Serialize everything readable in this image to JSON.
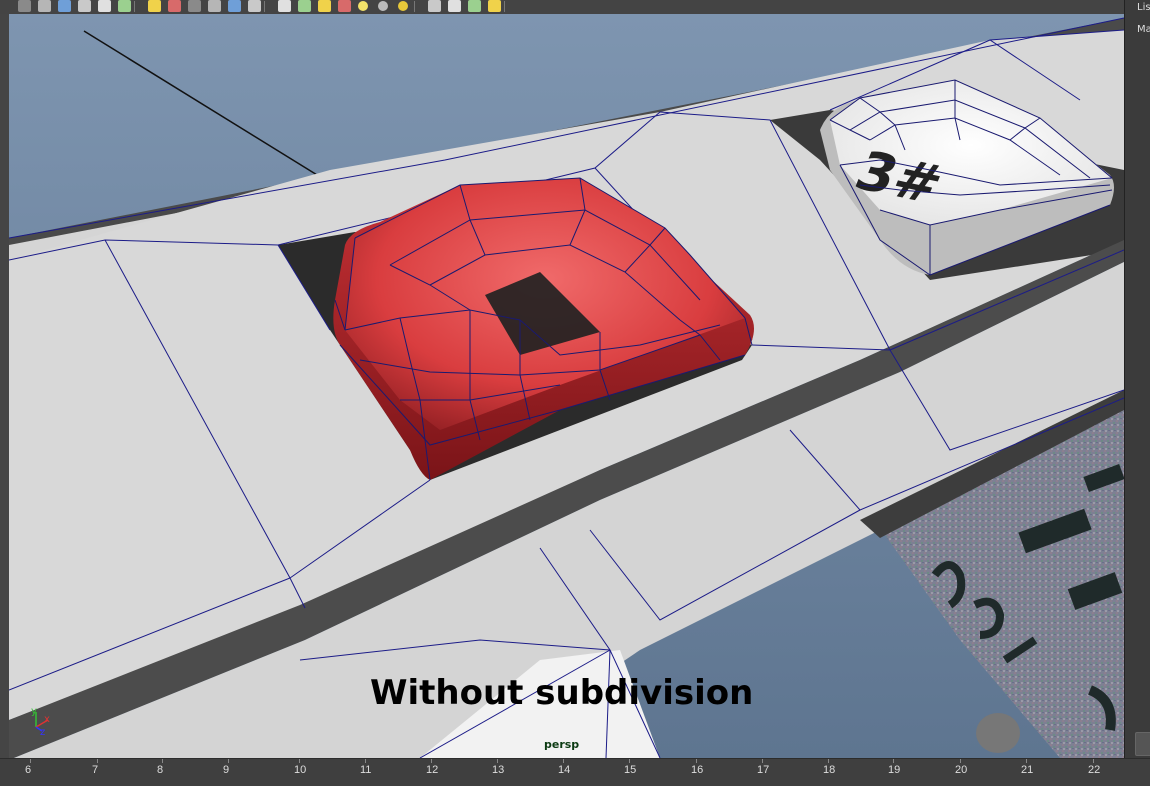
{
  "toolbar": {
    "groups": [
      {
        "icons": [
          "tool-a-icon",
          "tool-b-icon",
          "tool-c-icon",
          "tool-d-icon",
          "tool-e-icon",
          "tool-f-icon"
        ]
      },
      {
        "icons": [
          "wireframe-icon",
          "grid-shade-icon",
          "smooth-shade-icon",
          "default-light-icon",
          "all-lights-icon",
          "texture-icon"
        ]
      },
      {
        "icons": [
          "camera-icon",
          "isolate-icon",
          "xray-icon",
          "checker-icon",
          "light-sphere-icon",
          "grey-sphere-icon",
          "yellow-sphere-icon"
        ]
      },
      {
        "icons": [
          "select-icon",
          "cube-icon",
          "layout-icon",
          "share-icon"
        ]
      }
    ]
  },
  "right_panel": {
    "line1": "Lis",
    "line2": "Ma"
  },
  "viewport": {
    "caption": "Without subdivision",
    "camera": "persp",
    "axis_labels": {
      "y": "y",
      "x": "x",
      "z": "z"
    },
    "key_front_text": "3#"
  },
  "timeline": {
    "ticks": [
      "6",
      "7",
      "8",
      "9",
      "10",
      "11",
      "12",
      "13",
      "14",
      "15",
      "16",
      "17",
      "18",
      "19",
      "20",
      "21",
      "22"
    ]
  },
  "colors": {
    "background_top": "#7d93ad",
    "key_red": "#d93d3f",
    "wireframe": "#1c1c88",
    "panel_grey": "#d9d9d9"
  }
}
